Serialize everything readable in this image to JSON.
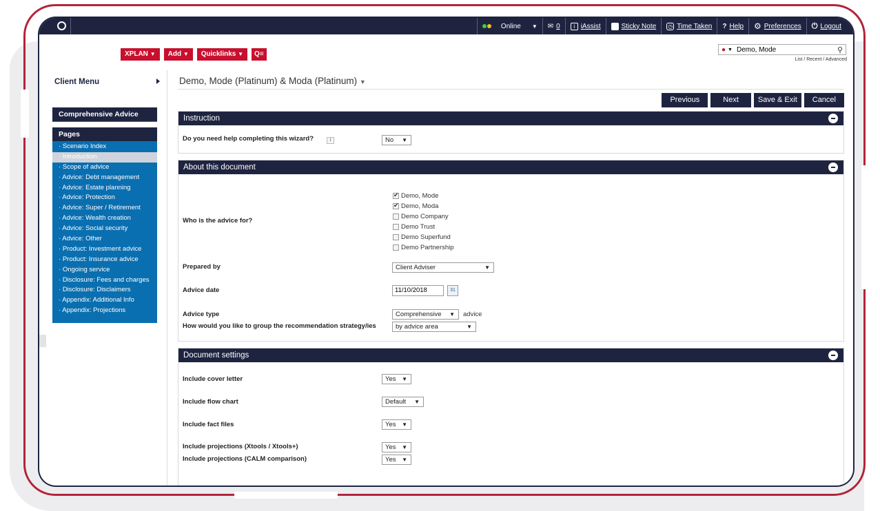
{
  "topbar": {
    "status": "Online",
    "mail_count": "0",
    "iassist": "iAssist",
    "sticky_note": "Sticky Note",
    "time_taken": "Time Taken",
    "help": "Help",
    "preferences": "Preferences",
    "logout": "Logout"
  },
  "toolbar": {
    "xplan": "XPLAN",
    "add": "Add",
    "quicklinks": "Quicklinks"
  },
  "search": {
    "client": "Demo, Mode",
    "links": "List / Recent / Advanced"
  },
  "client_menu": "Client Menu",
  "nav": {
    "section": "Comprehensive Advice",
    "pages_label": "Pages",
    "items": [
      "Scenario Index",
      "Introduction",
      "Scope of advice",
      "Advice: Debt management",
      "Advice: Estate planning",
      "Advice: Protection",
      "Advice: Super / Retirement",
      "Advice: Wealth creation",
      "Advice: Social security",
      "Advice: Other",
      "Product: Investment advice",
      "Product: Insurance advice",
      "Ongoing service",
      "Disclosure: Fees and charges",
      "Disclosure: Disclaimers",
      "Appendix: Additional Info",
      "Appendix: Projections"
    ]
  },
  "page_title": "Demo, Mode (Platinum) & Moda (Platinum)",
  "actions": {
    "previous": "Previous",
    "next": "Next",
    "save_exit": "Save & Exit",
    "cancel": "Cancel"
  },
  "instruction": {
    "title": "Instruction",
    "help_label": "Do you need help completing this wizard?",
    "help_value": "No"
  },
  "about": {
    "title": "About this document",
    "advice_for_label": "Who is the advice for?",
    "options": [
      {
        "label": "Demo, Mode",
        "checked": true
      },
      {
        "label": "Demo, Moda",
        "checked": true
      },
      {
        "label": "Demo Company",
        "checked": false
      },
      {
        "label": "Demo Trust",
        "checked": false
      },
      {
        "label": "Demo Superfund",
        "checked": false
      },
      {
        "label": "Demo Partnership",
        "checked": false
      }
    ],
    "prepared_by_label": "Prepared by",
    "prepared_by_value": "Client Adviser",
    "advice_date_label": "Advice date",
    "advice_date_value": "11/10/2018",
    "advice_type_label": "Advice type",
    "advice_type_value": "Comprehensive",
    "advice_type_suffix": "advice",
    "group_label": "How would you like to group the recommendation strategy/ies",
    "group_value": "by advice area"
  },
  "settings": {
    "title": "Document settings",
    "cover_letter_label": "Include cover letter",
    "cover_letter_value": "Yes",
    "flow_chart_label": "Include flow chart",
    "flow_chart_value": "Default",
    "fact_files_label": "Include fact files",
    "fact_files_value": "Yes",
    "proj_xtools_label": "Include projections (Xtools / Xtools+)",
    "proj_xtools_value": "Yes",
    "proj_calm_label": "Include projections (CALM comparison)",
    "proj_calm_value": "Yes"
  },
  "colors": {
    "navy": "#1e2440",
    "brand_red": "#c8102e",
    "nav_blue": "#0a6fb0",
    "frame_red": "#b1243a"
  }
}
